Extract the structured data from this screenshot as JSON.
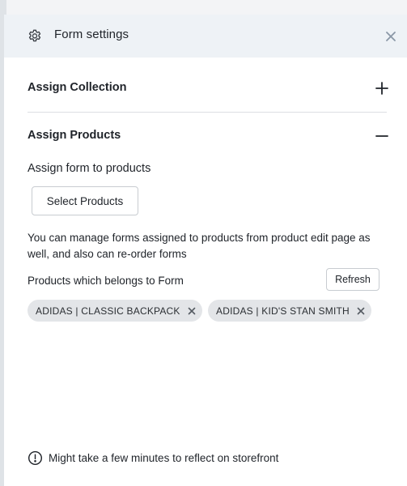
{
  "header": {
    "title": "Form settings",
    "icon": "gear-icon",
    "close_icon": "close-icon"
  },
  "sections": [
    {
      "title": "Assign Collection",
      "state": "collapsed",
      "toggle_icon": "plus-icon"
    },
    {
      "title": "Assign Products",
      "state": "expanded",
      "toggle_icon": "minus-icon"
    }
  ],
  "assign_products": {
    "sub_label": "Assign form to products",
    "select_button": "Select Products",
    "info_text": "You can manage forms assigned to products from product edit page as well, and also can re-order forms",
    "products_label": "Products which belongs to Form",
    "refresh_button": "Refresh",
    "products": [
      {
        "label": "ADIDAS | CLASSIC BACKPACK"
      },
      {
        "label": "ADIDAS | KID'S STAN SMITH"
      }
    ]
  },
  "footer": {
    "icon": "alert-circle-icon",
    "note": "Might take a few minutes to reflect on storefront"
  },
  "colors": {
    "header_bg": "#eef2f6",
    "chip_bg": "#e3e5e8",
    "text": "#1f2329"
  }
}
